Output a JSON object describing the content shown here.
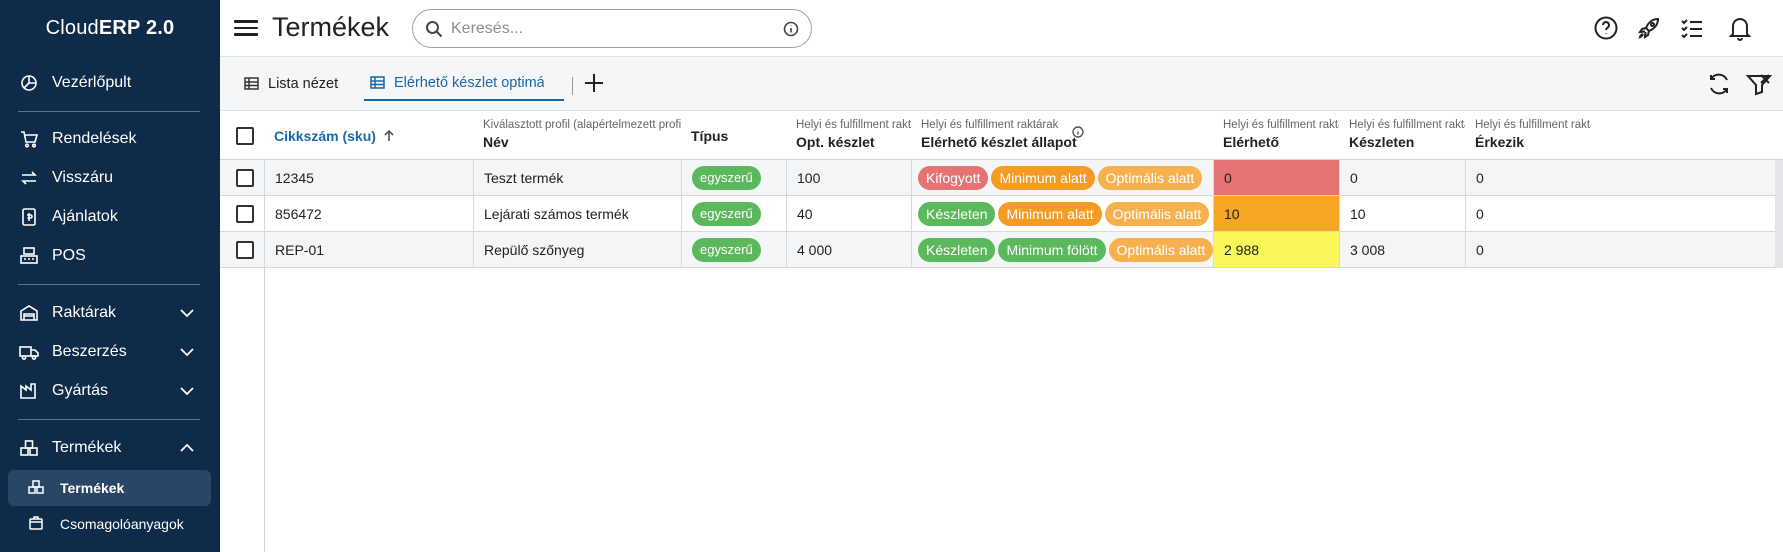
{
  "app": {
    "brand_light": "Cloud",
    "brand_bold": "ERP 2.0",
    "page_title": "Termékek"
  },
  "sidebar": {
    "items": [
      {
        "label": "Vezérlőpult",
        "icon": "dashboard-icon"
      },
      {
        "label": "Rendelések",
        "icon": "cart-icon"
      },
      {
        "label": "Visszáru",
        "icon": "return-arrows-icon"
      },
      {
        "label": "Ajánlatok",
        "icon": "offer-document-icon"
      },
      {
        "label": "POS",
        "icon": "pos-register-icon"
      },
      {
        "label": "Raktárak",
        "icon": "warehouse-icon",
        "expandable": true,
        "expanded": false
      },
      {
        "label": "Beszerzés",
        "icon": "truck-icon",
        "expandable": true,
        "expanded": false
      },
      {
        "label": "Gyártás",
        "icon": "factory-icon",
        "expandable": true,
        "expanded": false
      },
      {
        "label": "Termékek",
        "icon": "boxes-icon",
        "expandable": true,
        "expanded": true
      }
    ],
    "sub_items": [
      {
        "label": "Termékek",
        "icon": "boxes-icon",
        "active": true
      },
      {
        "label": "Csomagolóanyagok",
        "icon": "package-icon",
        "active": false
      }
    ]
  },
  "search": {
    "placeholder": "Keresés..."
  },
  "tabs": [
    {
      "label": "Lista nézet",
      "active": false
    },
    {
      "label": "Elérhető készlet optimális",
      "active": true
    }
  ],
  "table": {
    "columns": [
      {
        "sup": "",
        "label": "Cikkszám (sku)",
        "sorted": "asc"
      },
      {
        "sup": "Kiválasztott profil (alapértelmezett profil)",
        "label": "Név"
      },
      {
        "sup": "",
        "label": "Típus"
      },
      {
        "sup": "Helyi és fulfillment raktárak",
        "label": "Opt. készlet"
      },
      {
        "sup": "Helyi és fulfillment raktárak",
        "label": "Elérhető készlet állapot",
        "info": true
      },
      {
        "sup": "Helyi és fulfillment raktárak",
        "label": "Elérhető"
      },
      {
        "sup": "Helyi és fulfillment raktárak",
        "label": "Készleten"
      },
      {
        "sup": "Helyi és fulfillment raktárak",
        "label": "Érkezik"
      }
    ],
    "rows": [
      {
        "sku": "12345",
        "name": "Teszt termék",
        "type": "egyszerű",
        "opt_stock": "100",
        "status": [
          {
            "label": "Kifogyott",
            "color": "#e57373"
          },
          {
            "label": "Minimum alatt",
            "color": "#f59a23"
          },
          {
            "label": "Optimális alatt",
            "color": "#f7b04e"
          }
        ],
        "available": "0",
        "available_color": "#e57373",
        "in_stock": "0",
        "incoming": "0"
      },
      {
        "sku": "856472",
        "name": "Lejárati számos termék",
        "type": "egyszerű",
        "opt_stock": "40",
        "status": [
          {
            "label": "Készleten",
            "color": "#5cb85c"
          },
          {
            "label": "Minimum alatt",
            "color": "#f59a23"
          },
          {
            "label": "Optimális alatt",
            "color": "#f7b04e"
          }
        ],
        "available": "10",
        "available_color": "#f5a623",
        "in_stock": "10",
        "incoming": "0"
      },
      {
        "sku": "REP-01",
        "name": "Repülő szőnyeg",
        "type": "egyszerű",
        "opt_stock": "4 000",
        "status": [
          {
            "label": "Készleten",
            "color": "#5cb85c"
          },
          {
            "label": "Minimum fölött",
            "color": "#5cb85c"
          },
          {
            "label": "Optimális alatt",
            "color": "#f7b04e"
          }
        ],
        "available": "2 988",
        "available_color": "#fbf75a",
        "in_stock": "3 008",
        "incoming": "0"
      }
    ]
  },
  "topbar_icons": [
    "help-icon",
    "rocket-icon",
    "task-list-icon",
    "bell-icon"
  ],
  "toolbar_icons": [
    "refresh-icon",
    "filter-off-icon"
  ],
  "colors": {
    "sidebar_bg": "#0f2b4a",
    "accent": "#1769aa",
    "type_badge": "#5cb85c"
  }
}
